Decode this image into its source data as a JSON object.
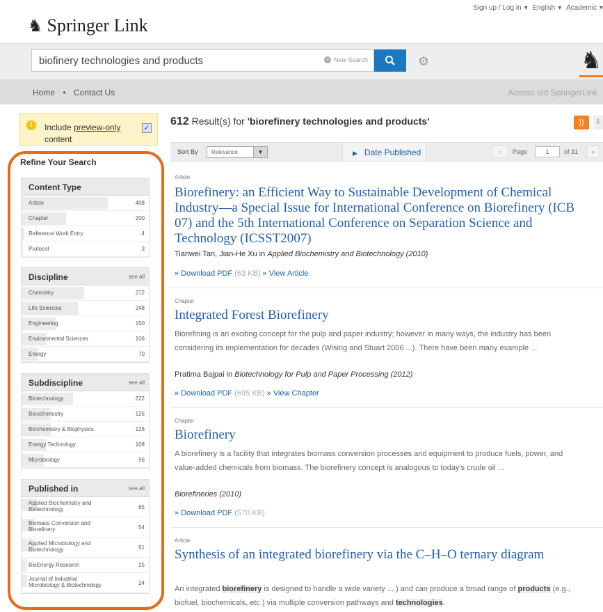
{
  "brand": {
    "name": "Springer",
    "suffix": "Link"
  },
  "toplinks": [
    "Sign up / Log in",
    "English",
    "Academic"
  ],
  "search": {
    "value": "biofinery technologies and products",
    "new_search": "New Search"
  },
  "nav": {
    "home": "Home",
    "contact": "Contact Us",
    "old": "Access old SpringerLink"
  },
  "preview": {
    "text_before": "Include ",
    "text_link": "preview-only",
    "text_after": " content",
    "checked": true
  },
  "refine_title": "Refine Your Search",
  "facets": [
    {
      "title": "Content Type",
      "see_all": "",
      "items": [
        {
          "label": "Article",
          "count": "408",
          "fill": 0.62
        },
        {
          "label": "Chapter",
          "count": "200",
          "fill": 0.32
        },
        {
          "label": "Reference Work Entry",
          "count": "4",
          "fill": 0.02
        },
        {
          "label": "Protocol",
          "count": "3",
          "fill": 0.01
        }
      ]
    },
    {
      "title": "Discipline",
      "see_all": "see all",
      "items": [
        {
          "label": "Chemistry",
          "count": "272",
          "fill": 0.45
        },
        {
          "label": "Life Sciences",
          "count": "248",
          "fill": 0.41
        },
        {
          "label": "Engineering",
          "count": "150",
          "fill": 0.25
        },
        {
          "label": "Environmental Sciences",
          "count": "106",
          "fill": 0.18
        },
        {
          "label": "Energy",
          "count": "70",
          "fill": 0.12
        }
      ]
    },
    {
      "title": "Subdiscipline",
      "see_all": "see all",
      "items": [
        {
          "label": "Biotechnology",
          "count": "222",
          "fill": 0.37
        },
        {
          "label": "Bioochemistry",
          "count": "126",
          "fill": 0.21
        },
        {
          "label": "Biochemistry & Biophysics",
          "count": "126",
          "fill": 0.21
        },
        {
          "label": "Energy Technology",
          "count": "108",
          "fill": 0.18
        },
        {
          "label": "Microbiology",
          "count": "96",
          "fill": 0.16
        }
      ]
    },
    {
      "title": "Published in",
      "see_all": "see all",
      "items": [
        {
          "label": "Applied Biochemistry and Biotechnology",
          "count": "65",
          "fill": 0.11
        },
        {
          "label": "Biomass Conversion and Biorefinery",
          "count": "54",
          "fill": 0.09
        },
        {
          "label": "Applied Microbiology and Biotechnology",
          "count": "51",
          "fill": 0.09
        },
        {
          "label": "BioEnergy Research",
          "count": "25",
          "fill": 0.04
        },
        {
          "label": "Journal of Industrial Microbiology & Biotechnology",
          "count": "24",
          "fill": 0.04
        }
      ]
    }
  ],
  "results_header": {
    "count": "612",
    "mid": " Result(s) for ",
    "query": "'biorefinery technologies and products'"
  },
  "sortbar": {
    "sort_by": "Sort By",
    "sort_value": "Relevance",
    "date": "Date Published",
    "page_label": "Page",
    "page_value": "1",
    "of": "of 31"
  },
  "results": [
    {
      "type": "Article",
      "title": "Biorefinery: an Efficient Way to Sustainable Development of Chemical Industry—a Special Issue for International Conference on Biorefinery (ICB 07) and the 5th International Conference on Separation Science and Technology (ICSST2007)",
      "snippet": "",
      "authors": "Tianwei Tan, Jian-He Xu",
      "in_word": " in ",
      "source": "Applied Biochemistry and Biotechnology",
      "year": " (2010)",
      "download": "» Download PDF",
      "size": " (63 KB)",
      "view": " » View Article"
    },
    {
      "type": "Chapter",
      "title": "Integrated Forest Biorefinery",
      "snippet": "Biorefining is an exciting concept for the pulp and paper industry; however in many ways, the industry has been considering its implementation for decades (Wising and Stuart 2006 ...). There have been many example ...",
      "authors": "Pratima Bajpai",
      "in_word": " in ",
      "source": "Biotechnology for Pulp and Paper Processing",
      "year": " (2012)",
      "download": "» Download PDF",
      "size": " (695 KB)",
      "view": " » View Chapter"
    },
    {
      "type": "Chapter",
      "title": "Biorefinery",
      "snippet": "A biorefinery is a facility that integrates biomass conversion processes and equipment to produce fuels, power, and value-added chemicals from biomass. The biorefinery concept is analogous to today's crude oil ...",
      "authors": "",
      "in_word": "",
      "source": "Biorefineries",
      "year": " (2010)",
      "download": "» Download PDF",
      "size": " (570 KB)",
      "view": ""
    },
    {
      "type": "Article",
      "title": "Synthesis of an integrated biorefinery via the C–H–O ternary diagram",
      "snippet_parts": [
        "An integrated ",
        "biorefinery",
        " is designed to handle a wide variety ... ) and can produce a broad range of ",
        "products",
        " (e.g., biofuel, biochemicals, etc.) via multiple conversion pathways and ",
        "technologies",
        "."
      ]
    }
  ]
}
